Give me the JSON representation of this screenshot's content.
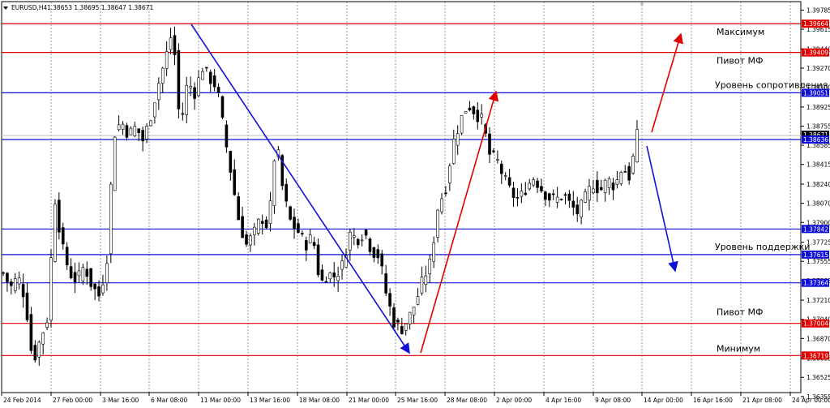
{
  "header": {
    "symbol": "EURUSD,H4",
    "ohlc": "1.38653 1.38695 1.38647 1.38671"
  },
  "chart_data": {
    "type": "candlestick",
    "title": "",
    "price_range": [
      1.3639,
      1.3986
    ],
    "grid": true,
    "y_ticks": [
      "1.39785",
      "1.39615",
      "1.39440",
      "1.39270",
      "1.39100",
      "1.38925",
      "1.38755",
      "1.38585",
      "1.38415",
      "1.38240",
      "1.38070",
      "1.37900",
      "1.37725",
      "1.37555",
      "1.37385",
      "1.37210",
      "1.37040",
      "1.36870",
      "1.36695",
      "1.36525",
      "1.36355"
    ],
    "x_ticks": [
      "24 Feb 2014",
      "27 Feb 00:00",
      "3 Mar 16:00",
      "6 Mar 08:00",
      "11 Mar 00:00",
      "13 Mar 16:00",
      "18 Mar 08:00",
      "21 Mar 00:00",
      "25 Mar 16:00",
      "28 Mar 08:00",
      "2 Apr 00:00",
      "4 Apr 16:00",
      "9 Apr 08:00",
      "14 Apr 00:00",
      "16 Apr 16:00",
      "21 Apr 08:00",
      "24 Apr 00:00"
    ],
    "current_price": "1.38671",
    "levels": [
      {
        "value": 1.39664,
        "label": "1.39664",
        "color": "#e00000",
        "note": "Максимум"
      },
      {
        "value": 1.39409,
        "label": "1.39409",
        "color": "#e00000",
        "note": "Пивот МФ"
      },
      {
        "value": 1.39051,
        "label": "1.39051",
        "color": "#1010d8",
        "note": "Уровень сопротивления"
      },
      {
        "value": 1.38636,
        "label": "1.38636",
        "color": "#1010d8",
        "note": ""
      },
      {
        "value": 1.37842,
        "label": "1.37842",
        "color": "#1010d8",
        "note": ""
      },
      {
        "value": 1.37615,
        "label": "1.37615",
        "color": "#1010d8",
        "note": "Уровень поддержки"
      },
      {
        "value": 1.37364,
        "label": "1.37364",
        "color": "#1010d8",
        "note": ""
      },
      {
        "value": 1.37004,
        "label": "1.37004",
        "color": "#e00000",
        "note": "Пивот МФ"
      },
      {
        "value": 1.36719,
        "label": "1.36719",
        "color": "#e00000",
        "note": "Минимум"
      }
    ],
    "trend_lines": [
      {
        "from": [
          "13 Mar 00:00",
          1.3964
        ],
        "to": [
          "4 Apr 16:00",
          1.3672
        ],
        "color": "#1010d8",
        "arrow": true
      },
      {
        "from": [
          "4 Apr 16:00",
          1.3672
        ],
        "to": [
          "10 Apr 00:00",
          1.3902
        ],
        "color": "#e00000",
        "arrow": true
      },
      {
        "from": [
          "26 Apr",
          1.3858
        ],
        "to": [
          "27 Apr 20:00",
          1.3955
        ],
        "color": "#e00000",
        "arrow": true
      },
      {
        "from": [
          "26 Apr",
          1.3858
        ],
        "to": [
          "27 Apr 20:00",
          1.374
        ],
        "color": "#1010d8",
        "arrow": true
      }
    ],
    "price_path": [
      {
        "date": "24 Feb",
        "price": 1.3745
      },
      {
        "date": "25 Feb",
        "price": 1.3732
      },
      {
        "date": "26 Feb",
        "price": 1.3742
      },
      {
        "date": "26 Feb",
        "price": 1.3722
      },
      {
        "date": "27 Feb",
        "price": 1.3665
      },
      {
        "date": "27 Feb",
        "price": 1.3686
      },
      {
        "date": "28 Feb",
        "price": 1.3705
      },
      {
        "date": "28 Feb",
        "price": 1.3812
      },
      {
        "date": "3 Mar",
        "price": 1.3768
      },
      {
        "date": "3 Mar",
        "price": 1.3745
      },
      {
        "date": "4 Mar",
        "price": 1.3738
      },
      {
        "date": "4 Mar",
        "price": 1.3752
      },
      {
        "date": "5 Mar",
        "price": 1.3734
      },
      {
        "date": "5 Mar",
        "price": 1.3725
      },
      {
        "date": "6 Mar",
        "price": 1.3752
      },
      {
        "date": "6 Mar",
        "price": 1.3868
      },
      {
        "date": "7 Mar",
        "price": 1.388
      },
      {
        "date": "10 Mar",
        "price": 1.3868
      },
      {
        "date": "10 Mar",
        "price": 1.3875
      },
      {
        "date": "11 Mar",
        "price": 1.3862
      },
      {
        "date": "11 Mar",
        "price": 1.3885
      },
      {
        "date": "12 Mar",
        "price": 1.3912
      },
      {
        "date": "12 Mar",
        "price": 1.3935
      },
      {
        "date": "13 Mar",
        "price": 1.3962
      },
      {
        "date": "13 Mar",
        "price": 1.3872
      },
      {
        "date": "14 Mar",
        "price": 1.3915
      },
      {
        "date": "14 Mar",
        "price": 1.3905
      },
      {
        "date": "17 Mar",
        "price": 1.3928
      },
      {
        "date": "17 Mar",
        "price": 1.3918
      },
      {
        "date": "18 Mar",
        "price": 1.391
      },
      {
        "date": "18 Mar",
        "price": 1.3868
      },
      {
        "date": "19 Mar",
        "price": 1.383
      },
      {
        "date": "19 Mar",
        "price": 1.379
      },
      {
        "date": "20 Mar",
        "price": 1.377
      },
      {
        "date": "20 Mar",
        "price": 1.378
      },
      {
        "date": "21 Mar",
        "price": 1.3795
      },
      {
        "date": "21 Mar",
        "price": 1.3785
      },
      {
        "date": "24 Mar",
        "price": 1.3865
      },
      {
        "date": "24 Mar",
        "price": 1.3815
      },
      {
        "date": "25 Mar",
        "price": 1.379
      },
      {
        "date": "25 Mar",
        "price": 1.3782
      },
      {
        "date": "26 Mar",
        "price": 1.377
      },
      {
        "date": "26 Mar",
        "price": 1.3778
      },
      {
        "date": "27 Mar",
        "price": 1.3735
      },
      {
        "date": "27 Mar",
        "price": 1.3745
      },
      {
        "date": "28 Mar",
        "price": 1.3742
      },
      {
        "date": "28 Mar",
        "price": 1.3752
      },
      {
        "date": "31 Mar",
        "price": 1.378
      },
      {
        "date": "31 Mar",
        "price": 1.3775
      },
      {
        "date": "1 Apr",
        "price": 1.3782
      },
      {
        "date": "1 Apr",
        "price": 1.3765
      },
      {
        "date": "2 Apr",
        "price": 1.376
      },
      {
        "date": "2 Apr",
        "price": 1.3725
      },
      {
        "date": "3 Apr",
        "price": 1.3702
      },
      {
        "date": "3 Apr",
        "price": 1.3695
      },
      {
        "date": "4 Apr",
        "price": 1.3705
      },
      {
        "date": "4 Apr",
        "price": 1.372
      },
      {
        "date": "7 Apr",
        "price": 1.374
      },
      {
        "date": "7 Apr",
        "price": 1.3755
      },
      {
        "date": "8 Apr",
        "price": 1.3805
      },
      {
        "date": "8 Apr",
        "price": 1.382
      },
      {
        "date": "9 Apr",
        "price": 1.386
      },
      {
        "date": "9 Apr",
        "price": 1.388
      },
      {
        "date": "10 Apr",
        "price": 1.3895
      },
      {
        "date": "10 Apr",
        "price": 1.3888
      },
      {
        "date": "11 Apr",
        "price": 1.388
      },
      {
        "date": "11 Apr",
        "price": 1.385
      },
      {
        "date": "14 Apr",
        "price": 1.3845
      },
      {
        "date": "14 Apr",
        "price": 1.3828
      },
      {
        "date": "15 Apr",
        "price": 1.3815
      },
      {
        "date": "15 Apr",
        "price": 1.381
      },
      {
        "date": "16 Apr",
        "price": 1.3822
      },
      {
        "date": "16 Apr",
        "price": 1.383
      },
      {
        "date": "17 Apr",
        "price": 1.382
      },
      {
        "date": "17 Apr",
        "price": 1.3812
      },
      {
        "date": "18 Apr",
        "price": 1.381
      },
      {
        "date": "18 Apr",
        "price": 1.3815
      },
      {
        "date": "21 Apr",
        "price": 1.3805
      },
      {
        "date": "21 Apr",
        "price": 1.3798
      },
      {
        "date": "22 Apr",
        "price": 1.3812
      },
      {
        "date": "22 Apr",
        "price": 1.3825
      },
      {
        "date": "23 Apr",
        "price": 1.3818
      },
      {
        "date": "23 Apr",
        "price": 1.3828
      },
      {
        "date": "24 Apr",
        "price": 1.3822
      },
      {
        "date": "24 Apr",
        "price": 1.384
      },
      {
        "date": "25 Apr",
        "price": 1.383
      },
      {
        "date": "25 Apr",
        "price": 1.3867
      }
    ]
  },
  "colors": {
    "candle": "#000000",
    "grid": "#808080",
    "red_level": "#e00000",
    "blue_level": "#1010d8",
    "current_price_line": "#c0c0c0"
  }
}
